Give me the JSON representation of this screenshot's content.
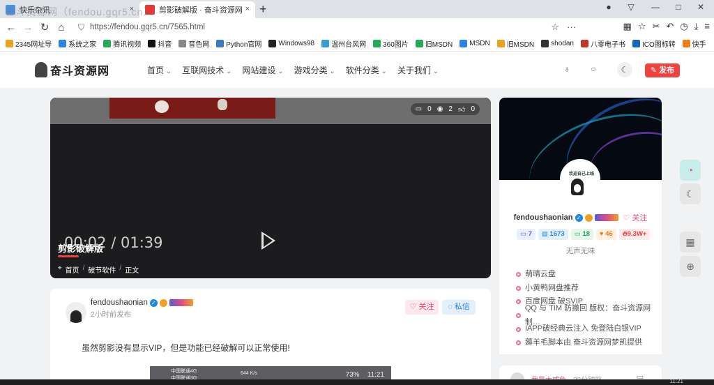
{
  "browser": {
    "tabs": [
      {
        "label": "快乐杂讯",
        "close": "×"
      },
      {
        "label": "剪影破解版 · 奋斗资源网",
        "close": "×"
      }
    ],
    "new_tab": "+",
    "url": "https://fendou.gqr5.cn/7565.html",
    "window_controls": [
      "—",
      "□",
      "✕"
    ]
  },
  "bookmarks": [
    {
      "label": "2345网址导",
      "color": "#f0a020"
    },
    {
      "label": "系统之家",
      "color": "#2b85e4"
    },
    {
      "label": "腾讯视频",
      "color": "#22aa55"
    },
    {
      "label": "抖音",
      "color": "#111111"
    },
    {
      "label": "音色网",
      "color": "#888888"
    },
    {
      "label": "Python官网",
      "color": "#3b7bbf"
    },
    {
      "label": "Windows98",
      "color": "#222222"
    },
    {
      "label": "温州台风网",
      "color": "#3a9bd5"
    },
    {
      "label": "360图片",
      "color": "#22aa55"
    },
    {
      "label": "旧MSDN",
      "color": "#22aa55"
    },
    {
      "label": "MSDN",
      "color": "#2b85e4"
    },
    {
      "label": "旧MSDN",
      "color": "#f0a020"
    },
    {
      "label": "shodan",
      "color": "#333333"
    },
    {
      "label": "八零电子书",
      "color": "#c0392b"
    },
    {
      "label": "ICO图标转",
      "color": "#1565c0"
    },
    {
      "label": "快手",
      "color": "#f07d1a"
    }
  ],
  "site": {
    "logo_text": "奋斗资源网",
    "nav": [
      "首页",
      "互联网技术",
      "网站建设",
      "游戏分类",
      "软件分类",
      "关于我们"
    ],
    "publish_label": "发布"
  },
  "video": {
    "stats": {
      "comments": "0",
      "views": "2",
      "likes": "0"
    },
    "time_current": "00:02",
    "time_separator": "/",
    "time_total": "01:39",
    "title": "剪影破解版",
    "breadcrumb": [
      "首页",
      "破节软件",
      "正文"
    ]
  },
  "post": {
    "author": "fendoushaonian",
    "time": "2小时前发布",
    "follow_label": "关注",
    "message_label": "私信",
    "body": "虽然剪影没有显示VIP，但是功能已经破解可以正常使用!",
    "phone_status": {
      "carrier1": "中国联通4G",
      "carrier2": "中国联通3G",
      "speed": "644 K/s",
      "battery": "73%",
      "clock": "11:21"
    }
  },
  "sidebar": {
    "avatar_caption": "欢迎自己上线",
    "name": "fendoushaonian",
    "follow_label": "关注",
    "stats": [
      "7",
      "1673",
      "18",
      "46",
      "9.3W+"
    ],
    "bio": "无声无味",
    "links": [
      "萌晴云盘",
      "小黄鸭网盘推荐",
      "百度网盘 破SVIP",
      "QQ 与 TIM 防撤回 版权：奋斗资源网 制…",
      "IAPP破经典云注入 免登陆白银VIP",
      "薅羊毛脚本由 奋斗资源网梦凯提供"
    ],
    "recent": {
      "name": "我是大咸鱼",
      "time": "22分钟前"
    }
  },
  "watermark": "奋斗资源网（fendou.gqr5.cn）",
  "taskbar_clock": "11:21"
}
